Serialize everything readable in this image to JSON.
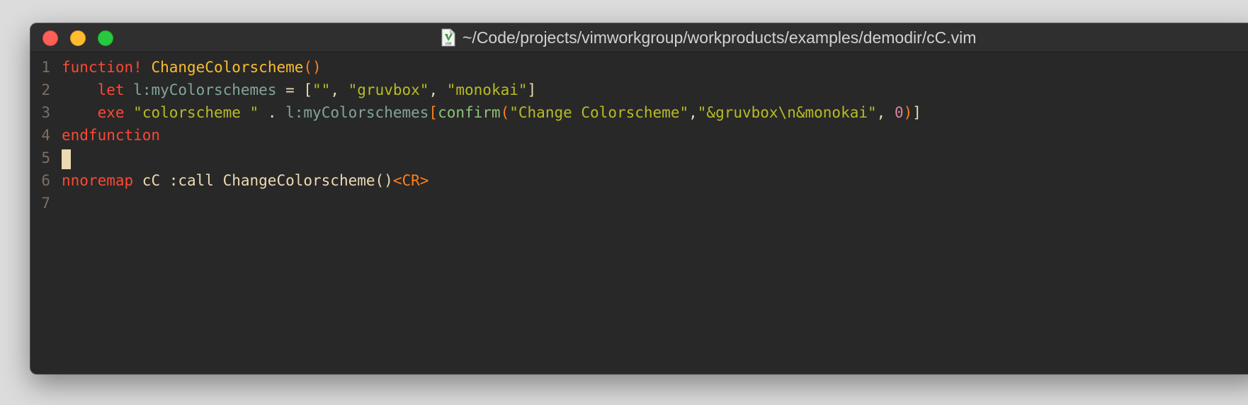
{
  "window": {
    "title": "~/Code/projects/vimworkgroup/workproducts/examples/demodir/cC.vim",
    "file_icon": "vim-file-icon"
  },
  "editor": {
    "lines": [
      {
        "number": "1",
        "tokens": [
          {
            "text": "function!",
            "cls": "kw"
          },
          {
            "text": " ",
            "cls": "tx"
          },
          {
            "text": "ChangeColorscheme",
            "cls": "fn"
          },
          {
            "text": "()",
            "cls": "pr"
          }
        ]
      },
      {
        "number": "2",
        "tokens": [
          {
            "text": "    ",
            "cls": "tx"
          },
          {
            "text": "let",
            "cls": "kw"
          },
          {
            "text": " ",
            "cls": "tx"
          },
          {
            "text": "l:myColorschemes",
            "cls": "var"
          },
          {
            "text": " = [",
            "cls": "tx"
          },
          {
            "text": "\"\"",
            "cls": "str"
          },
          {
            "text": ", ",
            "cls": "tx"
          },
          {
            "text": "\"gruvbox\"",
            "cls": "str"
          },
          {
            "text": ", ",
            "cls": "tx"
          },
          {
            "text": "\"monokai\"",
            "cls": "str"
          },
          {
            "text": "]",
            "cls": "tx"
          }
        ]
      },
      {
        "number": "3",
        "tokens": [
          {
            "text": "    ",
            "cls": "tx"
          },
          {
            "text": "exe",
            "cls": "kw"
          },
          {
            "text": " ",
            "cls": "tx"
          },
          {
            "text": "\"colorscheme \"",
            "cls": "str"
          },
          {
            "text": " . ",
            "cls": "tx"
          },
          {
            "text": "l:myColorschemes",
            "cls": "var"
          },
          {
            "text": "[",
            "cls": "pr"
          },
          {
            "text": "confirm",
            "cls": "bi"
          },
          {
            "text": "(",
            "cls": "pr"
          },
          {
            "text": "\"Change Colorscheme\"",
            "cls": "str"
          },
          {
            "text": ",",
            "cls": "tx"
          },
          {
            "text": "\"&gruvbox\\n&monokai\"",
            "cls": "str"
          },
          {
            "text": ", ",
            "cls": "tx"
          },
          {
            "text": "0",
            "cls": "num"
          },
          {
            "text": ")",
            "cls": "pr"
          },
          {
            "text": "]",
            "cls": "tx"
          }
        ]
      },
      {
        "number": "4",
        "tokens": [
          {
            "text": "endfunction",
            "cls": "kw"
          }
        ]
      },
      {
        "number": "5",
        "tokens": [],
        "cursor": true
      },
      {
        "number": "6",
        "tokens": [
          {
            "text": "nnoremap",
            "cls": "kw"
          },
          {
            "text": " cC :call ChangeColorscheme()",
            "cls": "tx"
          },
          {
            "text": "<CR>",
            "cls": "pr"
          }
        ]
      },
      {
        "number": "7",
        "tokens": []
      }
    ]
  },
  "colors": {
    "background": "#282828",
    "foreground": "#ebdbb2",
    "keyword": "#fb4934",
    "function": "#fabd2f",
    "paren": "#fe8019",
    "variable": "#83a598",
    "string": "#b8bb26",
    "number": "#d3869b",
    "builtin": "#8ec07c",
    "line_number": "#7c6f64"
  }
}
